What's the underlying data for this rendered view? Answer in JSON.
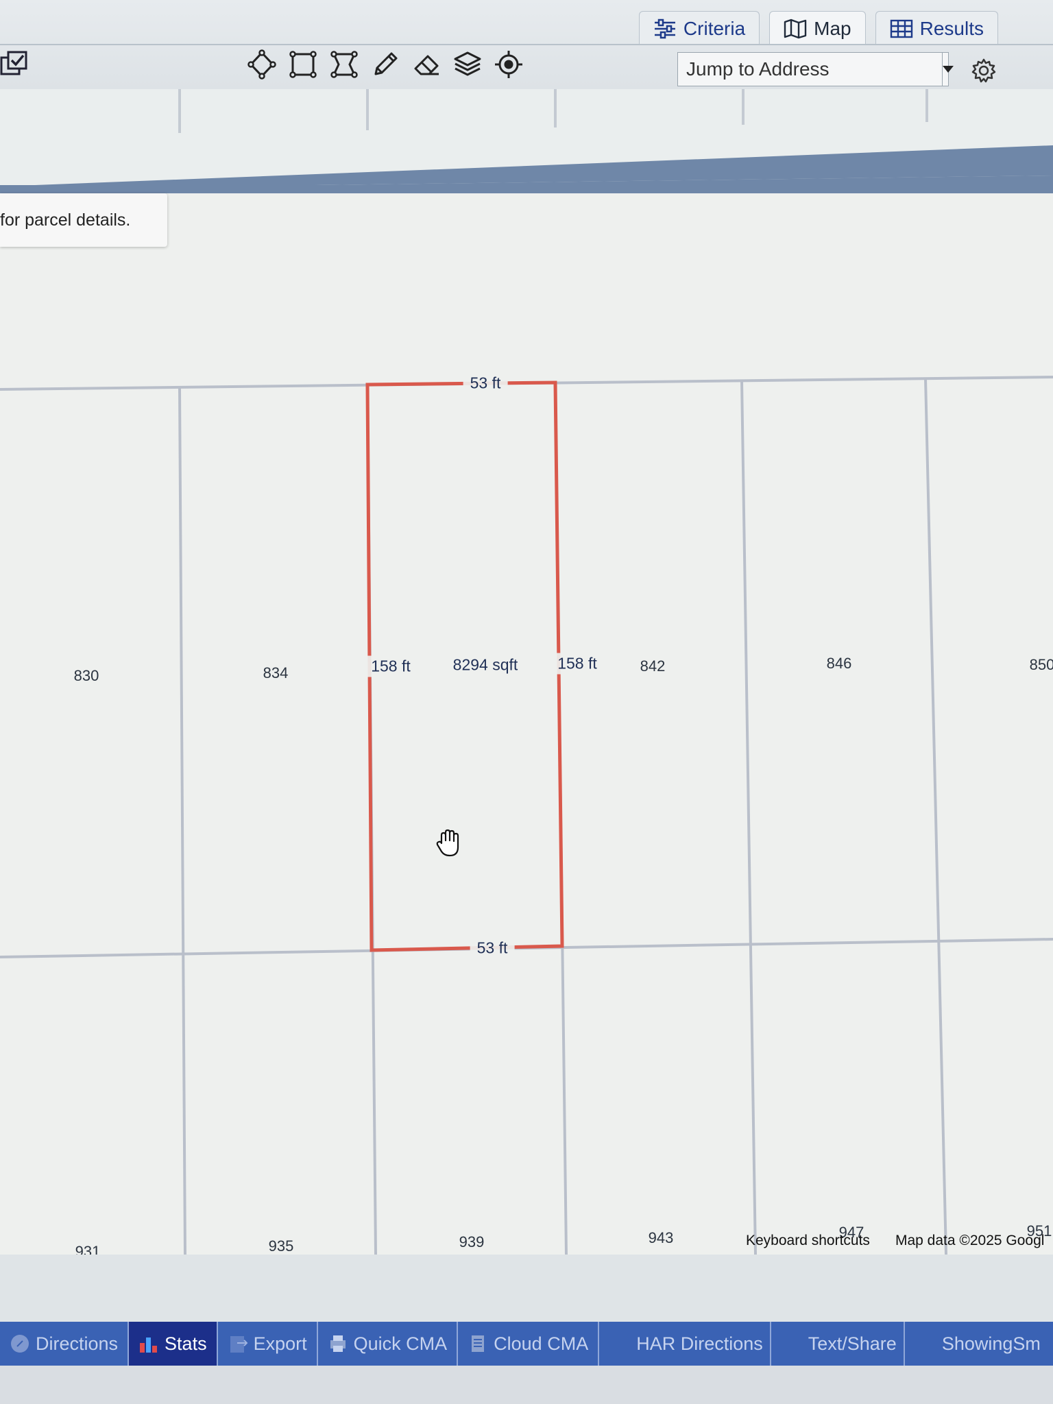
{
  "tabs": [
    {
      "label": "Criteria",
      "icon": "sliders-icon",
      "active": false
    },
    {
      "label": "Map",
      "icon": "map-icon",
      "active": true
    },
    {
      "label": "Results",
      "icon": "table-grid-icon",
      "active": false
    }
  ],
  "toolbar": {
    "tools": [
      "draw-polygon-icon",
      "draw-rectangle-icon",
      "edit-shape-icon",
      "pencil-icon",
      "eraser-icon",
      "layers-icon",
      "locate-target-icon"
    ]
  },
  "jump": {
    "placeholder": "Jump to Address"
  },
  "tooltip": {
    "text": "for parcel details."
  },
  "map": {
    "parcel_labels": {
      "row1": [
        "830",
        "834",
        "842",
        "846",
        "850"
      ],
      "row2": [
        "931",
        "935",
        "939",
        "943",
        "947",
        "951"
      ]
    },
    "selected_parcel": {
      "top_width": "53 ft",
      "bottom_width": "53 ft",
      "left_depth": "158 ft",
      "right_depth": "158 ft",
      "area": "8294 sqft",
      "outline_color": "#d9594c"
    },
    "attribution": {
      "shortcuts": "Keyboard shortcuts",
      "data": "Map data ©2025 Googl"
    }
  },
  "bottom_actions": [
    {
      "label": "Directions",
      "icon": "compass-icon",
      "active": false
    },
    {
      "label": "Stats",
      "icon": "bar-chart-icon",
      "active": true
    },
    {
      "label": "Export",
      "icon": "export-icon",
      "active": false
    },
    {
      "label": "Quick CMA",
      "icon": "printer-icon",
      "active": false
    },
    {
      "label": "Cloud CMA",
      "icon": "document-icon",
      "active": false
    },
    {
      "label": "HAR Directions",
      "icon": "",
      "active": false
    },
    {
      "label": "Text/Share",
      "icon": "",
      "active": false
    },
    {
      "label": "ShowingSm",
      "icon": "",
      "active": false
    }
  ]
}
